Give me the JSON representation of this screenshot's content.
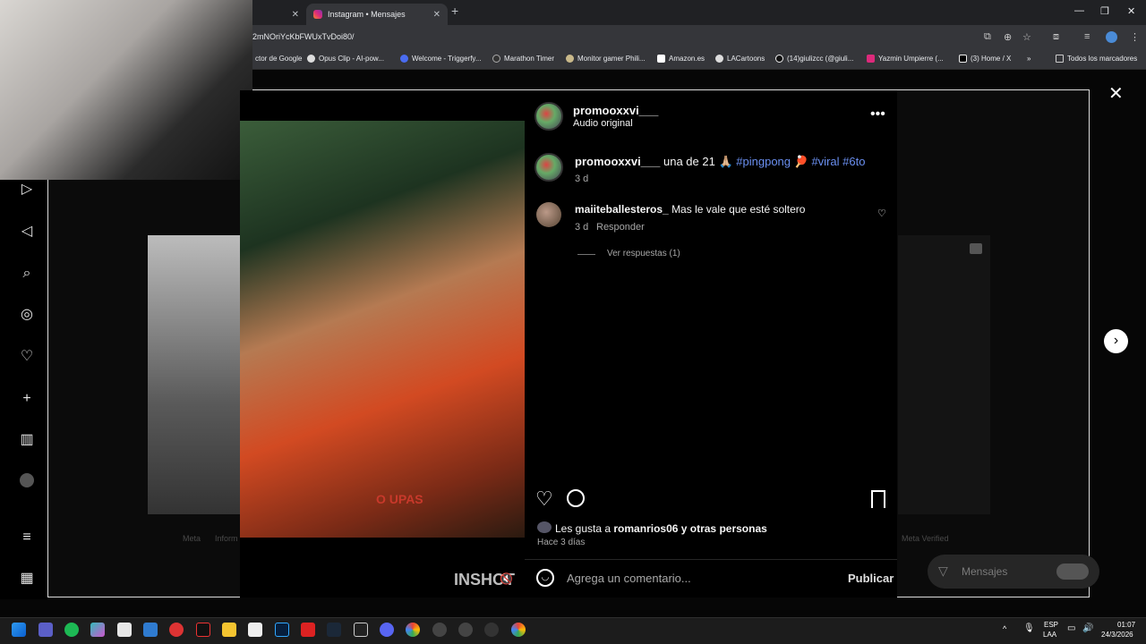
{
  "browser": {
    "tab_active": "Instagram • Mensajes",
    "url_fragment": "2mNOriYcKbFWUxTvDoi80/",
    "bookmarks": [
      "ctor de Google",
      "Opus Clip - AI-pow...",
      "Welcome - Triggerfy...",
      "Marathon Timer",
      "Monitor gamer Phili...",
      "Amazon.es",
      "LACartoons",
      "(14)giulizcc (@giuli...",
      "Yazmin Umpierre (...",
      "(3) Home / X",
      "Todos los marcadores"
    ]
  },
  "post": {
    "author": "promooxxvi___",
    "audio": "Audio original",
    "caption_user": "promooxxvi___",
    "caption_text": "una de 21",
    "caption_tag1": "#pingpong",
    "caption_tag2": "#viral",
    "caption_tag3": "#6to",
    "caption_age": "3 d",
    "comment": {
      "user": "maiiteballesteros_",
      "text": "Mas le vale que esté soltero",
      "age": "3 d",
      "reply": "Responder",
      "view_replies": "Ver respuestas (1)"
    },
    "likes_prefix": "Les gusta a",
    "likes_bold": "romanrios06 y otras personas",
    "date": "Hace 3 días",
    "comment_placeholder": "Agrega un comentario...",
    "publish": "Publicar"
  },
  "video": {
    "watermark": "INSHOT"
  },
  "background": {
    "footer_left": "Meta",
    "footer_left2": "Inform",
    "footer_right": "Meta Verified"
  },
  "mensajes": "Mensajes",
  "taskbar": {
    "lang1": "ESP",
    "lang2": "LAA",
    "time": "01:07",
    "date": "24/3/2026"
  }
}
